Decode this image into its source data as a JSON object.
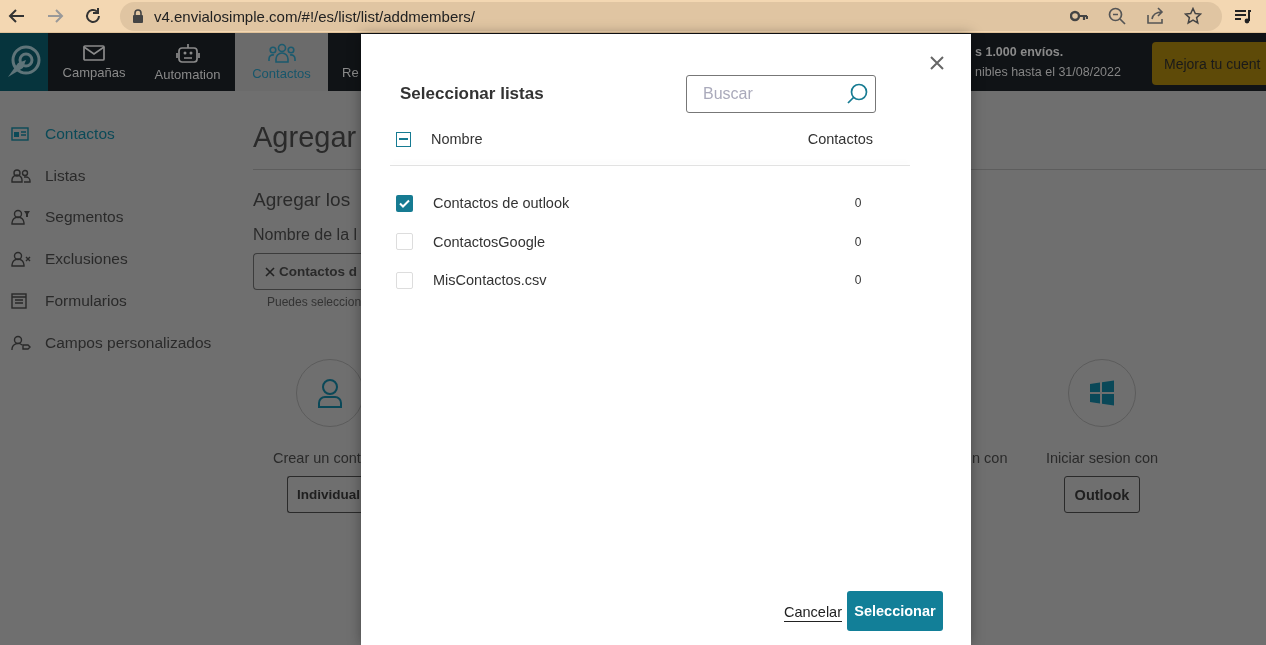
{
  "browser": {
    "url": "v4.envialosimple.com/#!/es/list/list/addmembers/"
  },
  "nav": {
    "items": [
      {
        "label": "Campañas",
        "selected": false
      },
      {
        "label": "Automation",
        "selected": false
      },
      {
        "label": "Contactos",
        "selected": true
      },
      {
        "label": "Re",
        "selected": false
      }
    ],
    "notice_line_1": "s 1.000 envíos.",
    "notice_line_2": "nibles hasta el 31/08/2022",
    "upgrade_button": "Mejora tu cuent"
  },
  "sidebar": {
    "items": [
      {
        "label": "Contactos",
        "selected": true
      },
      {
        "label": "Listas",
        "selected": false
      },
      {
        "label": "Segmentos",
        "selected": false
      },
      {
        "label": "Exclusiones",
        "selected": false
      },
      {
        "label": "Formularios",
        "selected": false
      },
      {
        "label": "Campos personalizados",
        "selected": false
      }
    ]
  },
  "main": {
    "title": "Agregar",
    "subtitle": "Agregar los",
    "list_name_label": "Nombre de la l",
    "chip": "Contactos d",
    "hint": "Puedes seleccion",
    "cards": [
      {
        "caption": "Crear un cont",
        "button": "Individual"
      },
      {
        "caption": "n con"
      },
      {
        "caption": "Iniciar sesion con",
        "button": "Outlook"
      }
    ]
  },
  "modal": {
    "title": "Seleccionar listas",
    "search": {
      "placeholder": "Buscar"
    },
    "header": {
      "indeterminate": true,
      "name_column": "Nombre",
      "count_column": "Contactos"
    },
    "rows": [
      {
        "name": "Contactos de outlook",
        "count": "0",
        "checked": true
      },
      {
        "name": "ContactosGoogle",
        "count": "0",
        "checked": false
      },
      {
        "name": "MisContactos.csv",
        "count": "0",
        "checked": false
      }
    ],
    "cancel": "Cancelar",
    "confirm": "Seleccionar"
  }
}
